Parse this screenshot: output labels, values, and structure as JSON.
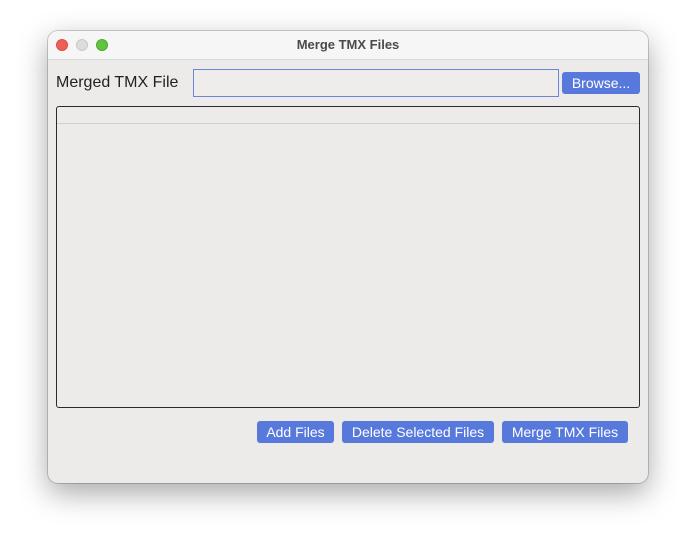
{
  "window": {
    "title": "Merge TMX Files"
  },
  "form": {
    "merged_file_label": "Merged TMX File",
    "merged_file_value": "",
    "browse_label": "Browse..."
  },
  "file_list": {
    "rows": []
  },
  "actions": {
    "add_files_label": "Add Files",
    "delete_selected_label": "Delete Selected Files",
    "merge_label": "Merge TMX Files"
  },
  "colors": {
    "accent": "#5779dc",
    "close": "#ee5f57",
    "minimize": "#dcdcdc",
    "maximize": "#5fc43f"
  }
}
